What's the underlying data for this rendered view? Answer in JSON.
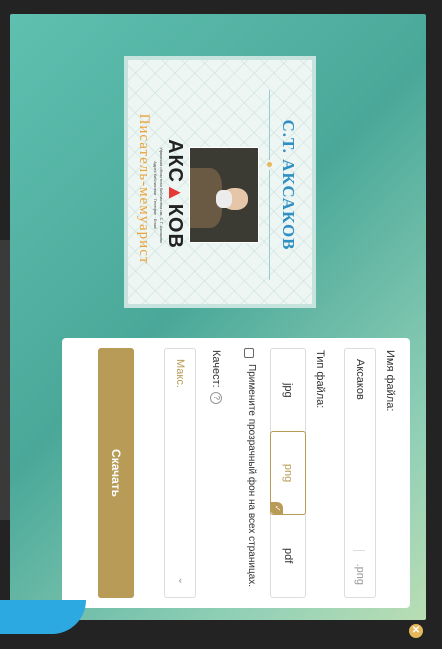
{
  "background": {
    "text": ""
  },
  "preview": {
    "title": "С.Т. АКСАКОВ",
    "logo_left": "АКС",
    "logo_tri": "▲",
    "logo_right": "КОВ",
    "line1": "Уфимская областная библиотека им. С.Т. Аксакова",
    "line2": "Адрес библиотеки · Телефон · Email",
    "subtitle": "Писатель-мемуарист"
  },
  "form": {
    "filename_label": "Имя файла:",
    "filename_value": "Аксаков",
    "filename_ext": ".png",
    "filetype_label": "Тип файла:",
    "types": [
      "jpg",
      "png",
      "pdf"
    ],
    "selected_type": "png",
    "transparent_label": "Примените прозрачный фон на всех страницах.",
    "quality_label": "Качест:",
    "quality_value": "Макс.",
    "download_label": "Скачать"
  },
  "colors": {
    "accent": "#b89b56",
    "teal": "#4aa899",
    "blue": "#2ca9e1"
  }
}
